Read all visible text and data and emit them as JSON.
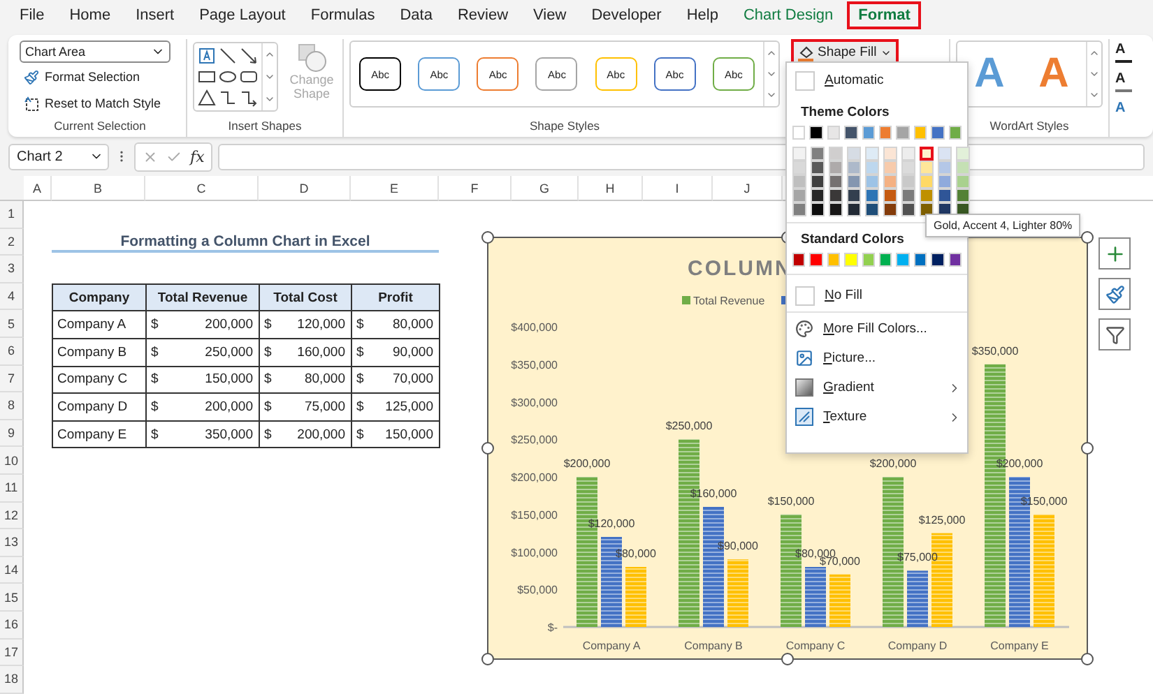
{
  "menu_tabs": [
    {
      "label": "File",
      "selected": false,
      "contextual": false,
      "highlighted": false
    },
    {
      "label": "Home",
      "selected": false,
      "contextual": false,
      "highlighted": false
    },
    {
      "label": "Insert",
      "selected": false,
      "contextual": false,
      "highlighted": false
    },
    {
      "label": "Page Layout",
      "selected": false,
      "contextual": false,
      "highlighted": false
    },
    {
      "label": "Formulas",
      "selected": false,
      "contextual": false,
      "highlighted": false
    },
    {
      "label": "Data",
      "selected": false,
      "contextual": false,
      "highlighted": false
    },
    {
      "label": "Review",
      "selected": false,
      "contextual": false,
      "highlighted": false
    },
    {
      "label": "View",
      "selected": false,
      "contextual": false,
      "highlighted": false
    },
    {
      "label": "Developer",
      "selected": false,
      "contextual": false,
      "highlighted": false
    },
    {
      "label": "Help",
      "selected": false,
      "contextual": false,
      "highlighted": false
    },
    {
      "label": "Chart Design",
      "selected": false,
      "contextual": true,
      "highlighted": false
    },
    {
      "label": "Format",
      "selected": true,
      "contextual": true,
      "highlighted": true
    }
  ],
  "ribbon": {
    "current_selection": {
      "dropdown": "Chart Area",
      "buttons": [
        "Format Selection",
        "Reset to Match Style"
      ],
      "group_label": "Current Selection"
    },
    "insert_shapes": {
      "change_shape": {
        "label": "Change Shape",
        "disabled": true
      },
      "group_label": "Insert Shapes"
    },
    "shape_styles": {
      "swatches": [
        {
          "label": "Abc",
          "color": "#000000"
        },
        {
          "label": "Abc",
          "color": "#5b9bd5"
        },
        {
          "label": "Abc",
          "color": "#ed7d31"
        },
        {
          "label": "Abc",
          "color": "#a5a5a5"
        },
        {
          "label": "Abc",
          "color": "#ffc000"
        },
        {
          "label": "Abc",
          "color": "#4472c4"
        },
        {
          "label": "Abc",
          "color": "#70ad47"
        }
      ],
      "group_label": "Shape Styles"
    },
    "shape_fill": {
      "label": "Shape Fill",
      "highlighted": true
    },
    "wordart_styles": {
      "letters": [
        {
          "label": "A",
          "color": "#5b9bd5"
        },
        {
          "label": "A",
          "color": "#ed7d31"
        }
      ],
      "group_label": "WordArt Styles"
    },
    "text_buttons": [
      {
        "kind": "fill",
        "label": "A"
      },
      {
        "kind": "outline",
        "label": "A"
      },
      {
        "kind": "effects",
        "label": "A"
      }
    ]
  },
  "formula_bar": {
    "name_box": "Chart 2",
    "fx": "fx"
  },
  "columns": [
    "A",
    "B",
    "C",
    "D",
    "E",
    "F",
    "G",
    "H",
    "I",
    "J"
  ],
  "rows": [
    "1",
    "2",
    "3",
    "4",
    "5",
    "6",
    "7",
    "8",
    "9",
    "10",
    "11",
    "12",
    "13",
    "14",
    "15",
    "16",
    "17",
    "18"
  ],
  "sheet": {
    "title": "Formatting a Column Chart in Excel",
    "table": {
      "columns": [
        "Company",
        "Total Revenue",
        "Total Cost",
        "Profit"
      ],
      "rows": [
        {
          "company": "Company A",
          "values": [
            {
              "currency": "$",
              "amount": "200,000"
            },
            {
              "currency": "$",
              "amount": "120,000"
            },
            {
              "currency": "$",
              "amount": "80,000"
            }
          ]
        },
        {
          "company": "Company B",
          "values": [
            {
              "currency": "$",
              "amount": "250,000"
            },
            {
              "currency": "$",
              "amount": "160,000"
            },
            {
              "currency": "$",
              "amount": "90,000"
            }
          ]
        },
        {
          "company": "Company C",
          "values": [
            {
              "currency": "$",
              "amount": "150,000"
            },
            {
              "currency": "$",
              "amount": "80,000"
            },
            {
              "currency": "$",
              "amount": "70,000"
            }
          ]
        },
        {
          "company": "Company D",
          "values": [
            {
              "currency": "$",
              "amount": "200,000"
            },
            {
              "currency": "$",
              "amount": "75,000"
            },
            {
              "currency": "$",
              "amount": "125,000"
            }
          ]
        },
        {
          "company": "Company E",
          "values": [
            {
              "currency": "$",
              "amount": "350,000"
            },
            {
              "currency": "$",
              "amount": "200,000"
            },
            {
              "currency": "$",
              "amount": "150,000"
            }
          ]
        }
      ]
    }
  },
  "chart": {
    "chart_data": {
      "type": "bar",
      "title": "COLUMN",
      "categories": [
        "Company A",
        "Company B",
        "Company C",
        "Company D",
        "Company E"
      ],
      "series": [
        {
          "name": "Total Revenue",
          "color": "#70ad47",
          "values": [
            200000,
            250000,
            150000,
            200000,
            350000
          ]
        },
        {
          "color": "#4472c4",
          "values": [
            120000,
            160000,
            80000,
            75000,
            200000
          ]
        },
        {
          "color": "#ffc000",
          "values": [
            80000,
            90000,
            70000,
            125000,
            150000
          ]
        }
      ],
      "ylim": [
        0,
        400000
      ],
      "yticks": [
        {
          "value": 0,
          "label": "$-"
        },
        {
          "value": 50000,
          "label": "$50,000"
        },
        {
          "value": 100000,
          "label": "$100,000"
        },
        {
          "value": 150000,
          "label": "$150,000"
        },
        {
          "value": 200000,
          "label": "$200,000"
        },
        {
          "value": 250000,
          "label": "$250,000"
        },
        {
          "value": 300000,
          "label": "$300,000"
        },
        {
          "value": 350000,
          "label": "$350,000"
        },
        {
          "value": 400000,
          "label": "$400,000"
        }
      ],
      "value_labels": [
        [
          "$200,000",
          "$250,000",
          "$150,000",
          "$200,000",
          "$350,000"
        ],
        [
          "$120,000",
          "$160,000",
          "$80,000",
          "$75,000",
          "$200,000"
        ],
        [
          "$80,000",
          "$90,000",
          "$70,000",
          "$125,000",
          "$150,000"
        ]
      ]
    }
  },
  "fill_menu": {
    "automatic": "Automatic",
    "theme_title": "Theme Colors",
    "theme_colors": [
      {
        "color": "#ffffff",
        "shades": [
          {
            "color": "#f2f2f2",
            "selected": false
          },
          {
            "color": "#d9d9d9",
            "selected": false
          },
          {
            "color": "#bfbfbf",
            "selected": false
          },
          {
            "color": "#a6a6a6",
            "selected": false
          },
          {
            "color": "#808080",
            "selected": false
          }
        ]
      },
      {
        "color": "#000000",
        "shades": [
          {
            "color": "#808080",
            "selected": false
          },
          {
            "color": "#595959",
            "selected": false
          },
          {
            "color": "#404040",
            "selected": false
          },
          {
            "color": "#262626",
            "selected": false
          },
          {
            "color": "#0d0d0d",
            "selected": false
          }
        ]
      },
      {
        "color": "#e7e6e6",
        "shades": [
          {
            "color": "#d0cece",
            "selected": false
          },
          {
            "color": "#aeaaaa",
            "selected": false
          },
          {
            "color": "#757171",
            "selected": false
          },
          {
            "color": "#3a3838",
            "selected": false
          },
          {
            "color": "#171616",
            "selected": false
          }
        ]
      },
      {
        "color": "#44546a",
        "shades": [
          {
            "color": "#d6dce4",
            "selected": false
          },
          {
            "color": "#adb9ca",
            "selected": false
          },
          {
            "color": "#8496b0",
            "selected": false
          },
          {
            "color": "#333f4f",
            "selected": false
          },
          {
            "color": "#222a35",
            "selected": false
          }
        ]
      },
      {
        "color": "#5b9bd5",
        "shades": [
          {
            "color": "#deebf6",
            "selected": false
          },
          {
            "color": "#bdd7ee",
            "selected": false
          },
          {
            "color": "#9dc3e6",
            "selected": false
          },
          {
            "color": "#2e75b5",
            "selected": false
          },
          {
            "color": "#1f4e79",
            "selected": false
          }
        ]
      },
      {
        "color": "#ed7d31",
        "shades": [
          {
            "color": "#fbe5d5",
            "selected": false
          },
          {
            "color": "#f7cbac",
            "selected": false
          },
          {
            "color": "#f4b183",
            "selected": false
          },
          {
            "color": "#c55a11",
            "selected": false
          },
          {
            "color": "#843c0b",
            "selected": false
          }
        ]
      },
      {
        "color": "#a5a5a5",
        "shades": [
          {
            "color": "#ededed",
            "selected": false
          },
          {
            "color": "#dbdbdb",
            "selected": false
          },
          {
            "color": "#c9c9c9",
            "selected": false
          },
          {
            "color": "#7b7b7b",
            "selected": false
          },
          {
            "color": "#525252",
            "selected": false
          }
        ]
      },
      {
        "color": "#ffc000",
        "shades": [
          {
            "color": "#fff2cc",
            "selected": true
          },
          {
            "color": "#ffe699",
            "selected": false
          },
          {
            "color": "#ffd966",
            "selected": false
          },
          {
            "color": "#bf9000",
            "selected": false
          },
          {
            "color": "#7f6000",
            "selected": false
          }
        ]
      },
      {
        "color": "#4472c4",
        "shades": [
          {
            "color": "#dae3f3",
            "selected": false
          },
          {
            "color": "#b4c7e7",
            "selected": false
          },
          {
            "color": "#8faadc",
            "selected": false
          },
          {
            "color": "#2f5597",
            "selected": false
          },
          {
            "color": "#203864",
            "selected": false
          }
        ]
      },
      {
        "color": "#70ad47",
        "shades": [
          {
            "color": "#e2f0d9",
            "selected": false
          },
          {
            "color": "#c5e0b4",
            "selected": false
          },
          {
            "color": "#a9d18e",
            "selected": false
          },
          {
            "color": "#538135",
            "selected": false
          },
          {
            "color": "#385723",
            "selected": false
          }
        ]
      }
    ],
    "standard_title": "Standard Colors",
    "standard_colors": [
      {
        "color": "#c00000"
      },
      {
        "color": "#ff0000"
      },
      {
        "color": "#ffc000"
      },
      {
        "color": "#ffff00"
      },
      {
        "color": "#92d050"
      },
      {
        "color": "#00b050"
      },
      {
        "color": "#00b0f0"
      },
      {
        "color": "#0070c0"
      },
      {
        "color": "#002060"
      },
      {
        "color": "#7030a0"
      }
    ],
    "items": [
      {
        "kind": "no_fill",
        "label": "No Fill",
        "submenu": false
      },
      {
        "kind": "more_colors",
        "label": "More Fill Colors...",
        "submenu": false
      },
      {
        "kind": "picture",
        "label": "Picture...",
        "submenu": false
      },
      {
        "kind": "gradient",
        "label": "Gradient",
        "submenu": true
      },
      {
        "kind": "texture",
        "label": "Texture",
        "submenu": true
      }
    ]
  },
  "tooltip": "Gold, Accent 4, Lighter 80%"
}
